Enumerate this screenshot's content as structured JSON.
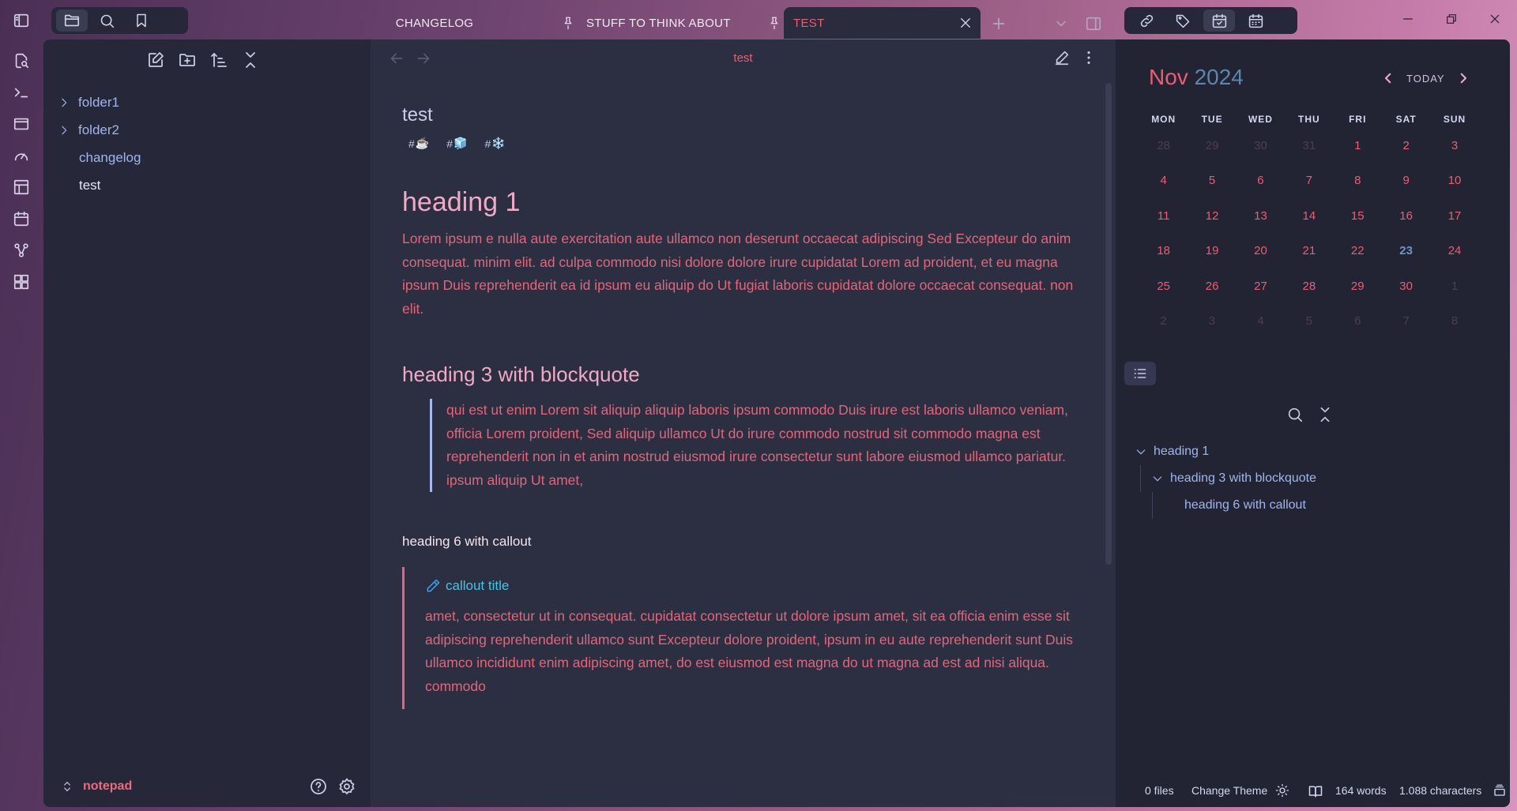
{
  "ribbon": {
    "items": [
      "sidebar-toggle-icon",
      "file-search-icon",
      "terminal-icon",
      "window-icon",
      "gauge-icon",
      "layout-icon",
      "calendar-icon",
      "graph-icon",
      "dashboard-icon"
    ]
  },
  "sidebar_tabs": [
    "files-icon",
    "search-icon",
    "bookmark-icon"
  ],
  "tabs": [
    {
      "label": "CHANGELOG",
      "pinned": false,
      "active": false
    },
    {
      "label": "STUFF TO THINK ABOUT",
      "pinned": true,
      "active": false
    },
    {
      "label": "TEST",
      "pinned": true,
      "active": true
    }
  ],
  "left_sidebar": {
    "tree": [
      {
        "label": "folder1",
        "type": "folder"
      },
      {
        "label": "folder2",
        "type": "folder"
      },
      {
        "label": "changelog",
        "type": "file"
      },
      {
        "label": "test",
        "type": "file",
        "active": true
      }
    ],
    "vault_name": "notepad"
  },
  "editor": {
    "view_title": "test",
    "inline_title": "test",
    "tags": [
      {
        "hash": "#",
        "emoji": "☕"
      },
      {
        "hash": "#",
        "emoji": "🧊"
      },
      {
        "hash": "#",
        "emoji": "❄️"
      }
    ],
    "heading1": "heading 1",
    "paragraph": "Lorem ipsum e nulla aute exercitation aute ullamco non deserunt occaecat adipiscing Sed Excepteur do anim consequat. minim elit. ad culpa commodo nisi dolore dolore irure cupidatat Lorem ad proident, et eu magna ipsum Duis reprehenderit ea id ipsum eu aliquip do Ut fugiat laboris cupidatat dolore occaecat consequat. non elit.",
    "heading3": "heading 3 with blockquote",
    "blockquote": "qui est ut enim Lorem sit aliquip aliquip laboris ipsum commodo Duis irure est laboris ullamco veniam, officia Lorem proident, Sed aliquip ullamco Ut do irure commodo nostrud sit commodo magna est reprehenderit non in et anim nostrud eiusmod irure consectetur sunt labore eiusmod ullamco pariatur. ipsum aliquip Ut amet,",
    "heading6": "heading 6 with callout",
    "callout_title": "callout title",
    "callout_body": "amet, consectetur ut in consequat. cupidatat consectetur ut dolore ipsum amet, sit ea officia enim esse sit adipiscing reprehenderit ullamco sunt Excepteur dolore proident, ipsum in eu aute reprehenderit sunt Duis ullamco incididunt enim adipiscing amet, do est eiusmod est magna do ut magna ad est ad nisi aliqua. commodo"
  },
  "calendar": {
    "month": "Nov",
    "year": "2024",
    "today_label": "TODAY",
    "weekdays": [
      "MON",
      "TUE",
      "WED",
      "THU",
      "FRI",
      "SAT",
      "SUN"
    ],
    "weeks": [
      [
        "28",
        "29",
        "30",
        "31",
        "1",
        "2",
        "3"
      ],
      [
        "4",
        "5",
        "6",
        "7",
        "8",
        "9",
        "10"
      ],
      [
        "11",
        "12",
        "13",
        "14",
        "15",
        "16",
        "17"
      ],
      [
        "18",
        "19",
        "20",
        "21",
        "22",
        "23",
        "24"
      ],
      [
        "25",
        "26",
        "27",
        "28",
        "29",
        "30",
        "1"
      ],
      [
        "2",
        "3",
        "4",
        "5",
        "6",
        "7",
        "8"
      ]
    ],
    "today": "23"
  },
  "outline": {
    "items": [
      {
        "label": "heading 1",
        "level": 1,
        "collapsible": true
      },
      {
        "label": "heading 3 with blockquote",
        "level": 2,
        "collapsible": true
      },
      {
        "label": "heading 6 with callout",
        "level": 3,
        "collapsible": false
      }
    ]
  },
  "status_bar": {
    "files": "0 files",
    "theme": "Change Theme",
    "words": "164 words",
    "characters": "1.088 characters"
  },
  "colors": {
    "accent": "#e85f73",
    "heading": "#f0a9c6",
    "link": "#9fb6ec",
    "today": "#6f95bf",
    "callout": "#4ec0e0"
  }
}
